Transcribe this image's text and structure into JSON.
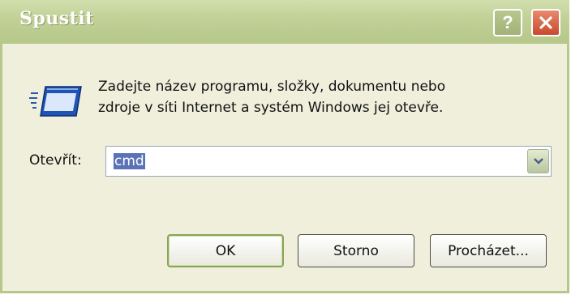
{
  "window": {
    "title": "Spustit",
    "description_line1": "Zadejte název programu, složky, dokumentu nebo",
    "description_line2": "zdroje v síti Internet a systém Windows jej otevře.",
    "open_label": "Otevřít:",
    "open_value": "cmd",
    "buttons": {
      "ok": "OK",
      "cancel": "Storno",
      "browse": "Procházet..."
    },
    "icons": {
      "help": "help-icon",
      "close": "close-icon",
      "run": "run-icon",
      "dropdown": "chevron-down-icon"
    },
    "colors": {
      "titlebar": "#b6c78a",
      "body": "#efefdc",
      "close": "#c8492d",
      "selection": "#5a73b6"
    }
  }
}
